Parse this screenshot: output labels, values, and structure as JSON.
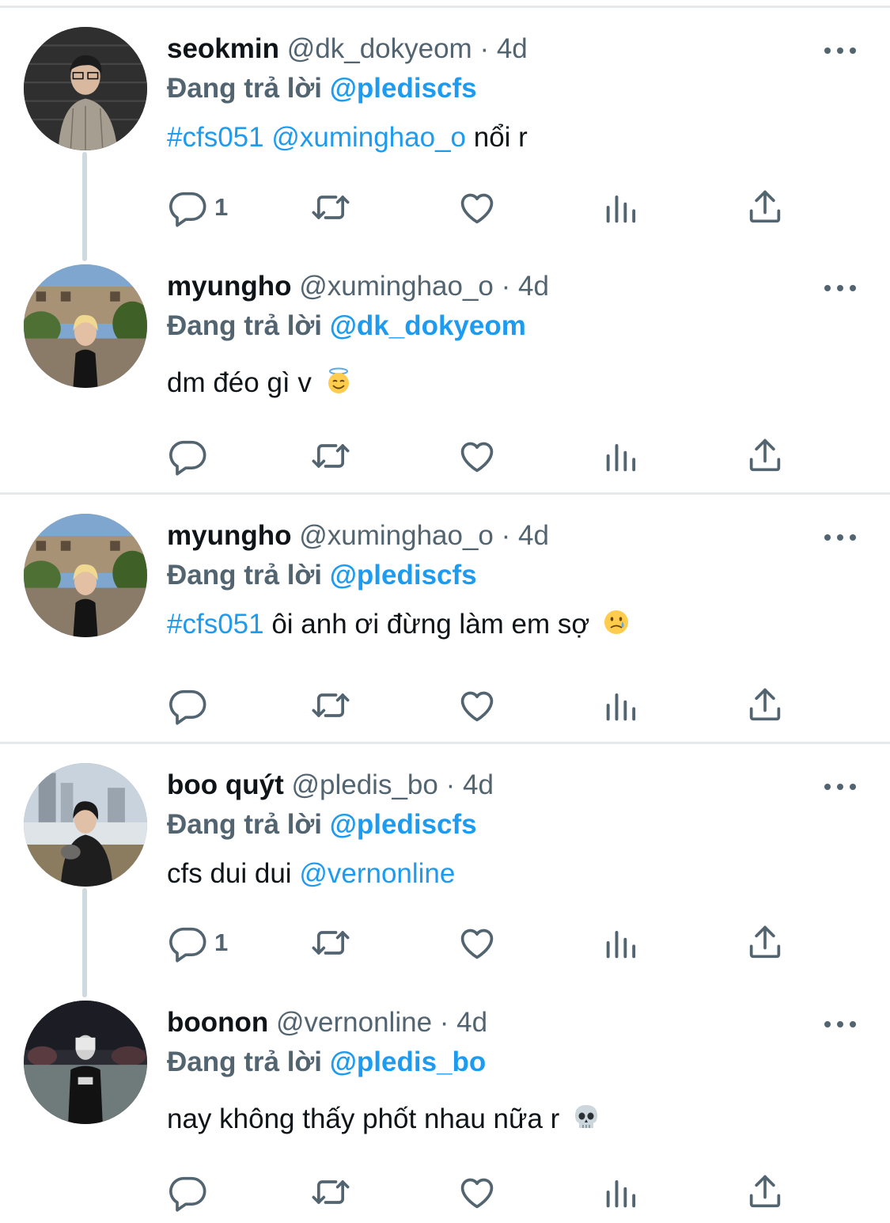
{
  "colors": {
    "accent": "#1d9bf0",
    "secondary": "#536471",
    "text": "#0f1419",
    "divider": "#e6e9ec"
  },
  "tweets": [
    {
      "name": "seokmin",
      "handle": "@dk_dokyeom",
      "sep": "·",
      "time": "4d",
      "reply_prefix": "Đang trả lời",
      "reply_to": "@plediscfs",
      "text_hashtag": "#cfs051",
      "text_mention": "@xuminghao_o",
      "text_after": "nổi r",
      "reply_count": "1",
      "avatar_icon": "avatar-photo"
    },
    {
      "name": "myungho",
      "handle": "@xuminghao_o",
      "sep": "·",
      "time": "4d",
      "reply_prefix": "Đang trả lời",
      "reply_to": "@dk_dokyeom",
      "text": "dm đéo gì v",
      "emoji": "halo-smile-emoji",
      "reply_count": "",
      "avatar_icon": "avatar-photo"
    },
    {
      "name": "myungho",
      "handle": "@xuminghao_o",
      "sep": "·",
      "time": "4d",
      "reply_prefix": "Đang trả lời",
      "reply_to": "@plediscfs",
      "text_hashtag": "#cfs051",
      "text_after": "ôi anh ơi đừng làm em sợ",
      "emoji": "tear-smile-emoji",
      "reply_count": "",
      "avatar_icon": "avatar-photo"
    },
    {
      "name": "boo quýt",
      "handle": "@pledis_bo",
      "sep": "·",
      "time": "4d",
      "reply_prefix": "Đang trả lời",
      "reply_to": "@plediscfs",
      "text_before": "cfs dui dui",
      "text_mention": "@vernonline",
      "reply_count": "1",
      "avatar_icon": "avatar-photo"
    },
    {
      "name": "boonon",
      "handle": "@vernonline",
      "sep": "·",
      "time": "4d",
      "reply_prefix": "Đang trả lời",
      "reply_to": "@pledis_bo",
      "text": "nay không thấy phốt nhau nữa r",
      "emoji": "skull-emoji",
      "reply_count": "",
      "avatar_icon": "avatar-photo"
    }
  ]
}
